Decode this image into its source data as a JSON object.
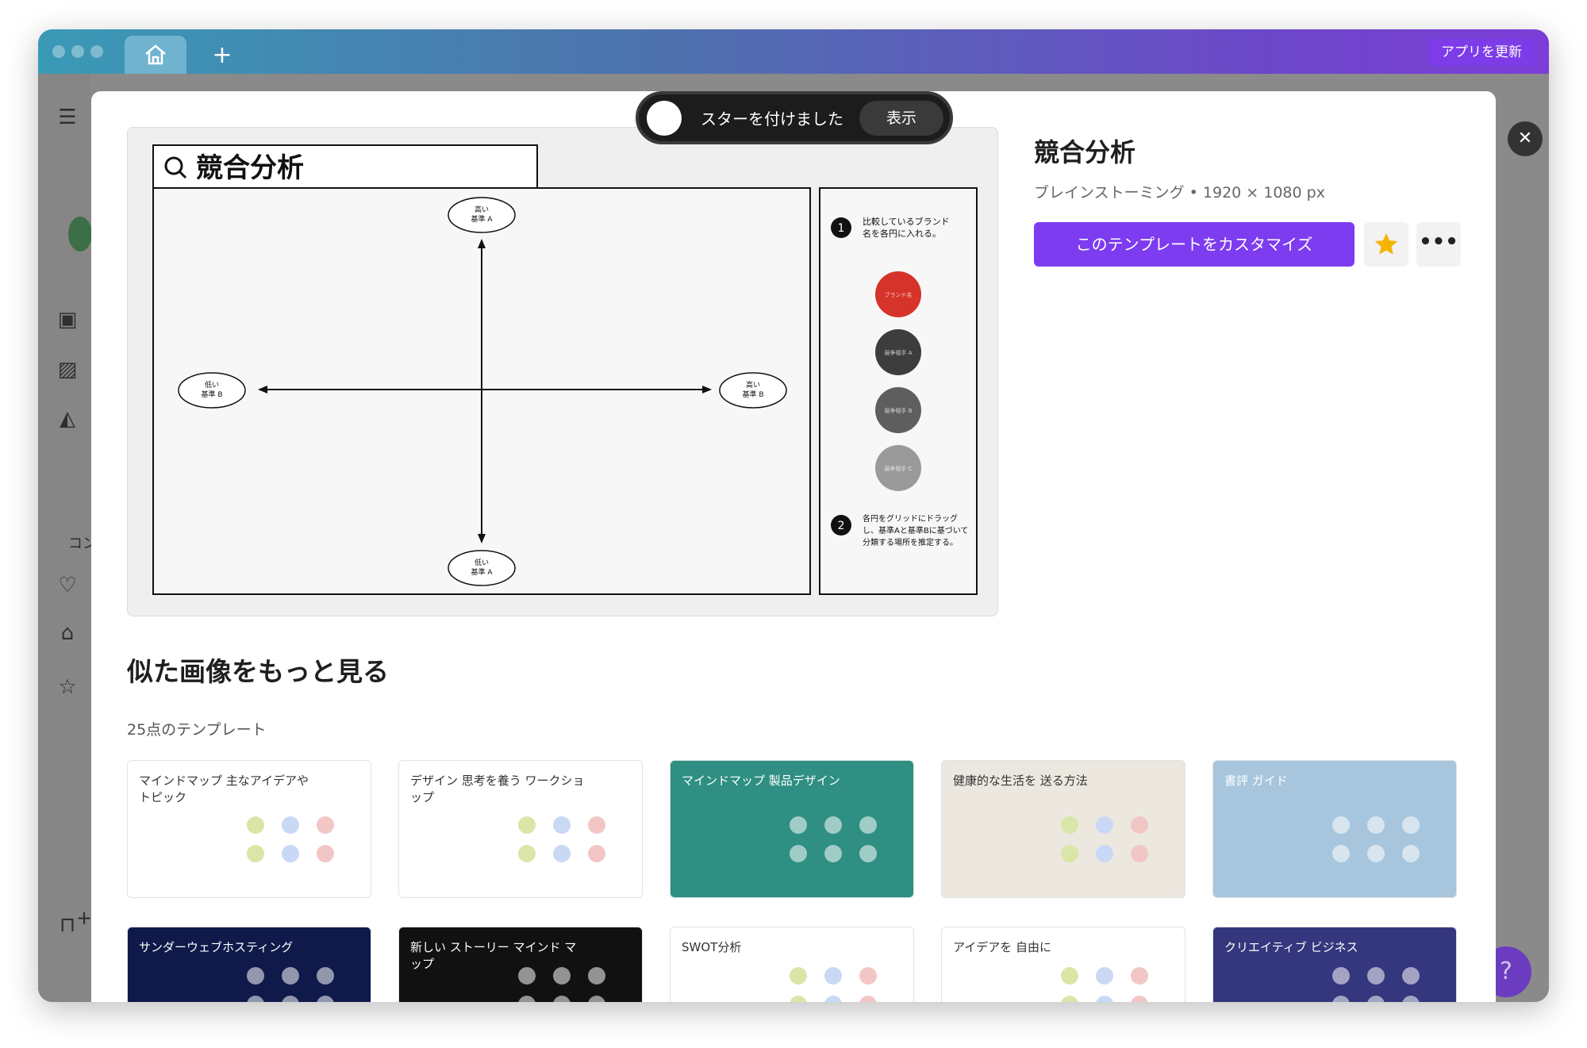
{
  "titlebar": {
    "update_label": "アプリを更新",
    "add_tab_symbol": "+"
  },
  "background": {
    "side_text": "コン",
    "side_add": "+",
    "help_symbol": "?",
    "close_symbol": "✕"
  },
  "toast": {
    "text": "スターを付けました",
    "button_label": "表示"
  },
  "template": {
    "title": "競合分析",
    "meta": "ブレインストーミング • 1920 × 1080 px",
    "customize_label": "このテンプレートをカスタマイズ",
    "more_label": "•••",
    "preview": {
      "search_title": "競合分析",
      "axis_top": [
        "高い",
        "基準 A"
      ],
      "axis_bottom": [
        "低い",
        "基準 A"
      ],
      "axis_left": [
        "低い",
        "基準 B"
      ],
      "axis_right": [
        "高い",
        "基準 B"
      ],
      "step1_number": "1",
      "step1_text": [
        "比較しているブランド",
        "名を各円に入れる。"
      ],
      "circles": [
        {
          "label": "ブランド名",
          "color": "#d6342a"
        },
        {
          "label": "競争相手 A",
          "color": "#3d3d3d"
        },
        {
          "label": "競争相手 B",
          "color": "#5e5e5e"
        },
        {
          "label": "競争相手 C",
          "color": "#9a9a9a"
        }
      ],
      "step2_number": "2",
      "step2_text": [
        "各円をグリッドにドラッグ",
        "し、基準Aと基準Bに基づいて",
        "分類する場所を推定する。"
      ]
    }
  },
  "similar": {
    "title": "似た画像をもっと見る",
    "count": "25点のテンプレート",
    "row1": [
      {
        "label": "マインドマップ 主なアイデアやトピック",
        "bg": "#ffffff"
      },
      {
        "label": "デザイン 思考を養う ワークショップ",
        "bg": "#ffffff"
      },
      {
        "label": "マインドマップ 製品デザイン",
        "bg": "#2e8f82"
      },
      {
        "label": "健康的な生活を 送る方法",
        "bg": "#ece8df"
      },
      {
        "label": "書評 ガイド",
        "bg": "#a7c6dd"
      }
    ],
    "row2": [
      {
        "label": "サンダーウェブホスティング",
        "bg": "#0f1a4a"
      },
      {
        "label": "新しい ストーリー マインド マップ",
        "bg": "#111111"
      },
      {
        "label": "SWOT分析",
        "bg": "#ffffff"
      },
      {
        "label": "アイデアを 自由に",
        "bg": "#ffffff"
      },
      {
        "label": "クリエイティブ ビジネス",
        "bg": "#34377d"
      }
    ]
  },
  "colors": {
    "accent": "#7d3cef",
    "star": "#f5b400"
  }
}
